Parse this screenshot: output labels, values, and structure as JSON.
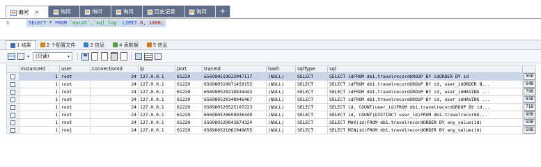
{
  "query_tabs": [
    {
      "label": "询问",
      "active": true
    },
    {
      "label": "询问",
      "active": false
    },
    {
      "label": "询问",
      "active": false
    },
    {
      "label": "询问",
      "active": false
    },
    {
      "label": "历史记录",
      "active": false
    },
    {
      "label": "询问",
      "active": false
    }
  ],
  "query_tab_close": "×",
  "query_tab_add": "+",
  "editor": {
    "line_number": "1",
    "kw_select": "SELECT",
    "star": " * ",
    "kw_from": "FROM",
    "table_ref": " `mycat`.`sql_log` ",
    "kw_limit": "LIMIT",
    "limit_values": " 0, 1000;"
  },
  "result_tabs": [
    {
      "label": "1 结果",
      "active": true,
      "color": "#3b6fb6"
    },
    {
      "label": "2 个配置文件",
      "active": false,
      "color": "#d08a1c"
    },
    {
      "label": "3 信息",
      "active": false,
      "color": "#2f7fcf"
    },
    {
      "label": "4 表数据",
      "active": false,
      "color": "#5a9a3a"
    },
    {
      "label": "5 信息",
      "active": false,
      "color": "#d07a1c"
    }
  ],
  "toolbar": {
    "readonly_select": "(只读)",
    "icons": [
      "grid-view-icon",
      "export-icon",
      "save-icon",
      "copy-icon",
      "paste-icon",
      "delete-icon",
      "filter-icon",
      "text-view-icon",
      "form-view-icon"
    ]
  },
  "grid": {
    "columns": [
      "instanceId",
      "user",
      "connectionId",
      "ip",
      "port",
      "traceId",
      "hash",
      "sqlType",
      "sql"
    ],
    "rows": [
      {
        "instanceId": "1",
        "user": "root",
        "connectionId": "24",
        "ip": "127.0.0.1",
        "port": "61220",
        "traceId": "656980519833047117",
        "hash": "(NULL)",
        "sqlType": "SELECT",
        "sql": "SELECT idFROM db1.travelrecordGROUP BY idORDER BY id",
        "size": "55B",
        "selected": true
      },
      {
        "instanceId": "1",
        "user": "root",
        "connectionId": "24",
        "ip": "127.0.0.1",
        "port": "61220",
        "traceId": "656980519971459155",
        "hash": "(NULL)",
        "sqlType": "SELECT",
        "sql": "SELECT idFROM db1.travelrecordGROUP BY id, user_idORDER B...",
        "size": "64B",
        "selected": false
      },
      {
        "instanceId": "1",
        "user": "root",
        "connectionId": "24",
        "ip": "127.0.0.1",
        "port": "61220",
        "traceId": "656980520210834443",
        "hash": "(NULL)",
        "sqlType": "SELECT",
        "sql": "SELECT idFROM db1.travelrecordGROUP BY id, user_idHAVING ...",
        "size": "79B",
        "selected": false
      },
      {
        "instanceId": "1",
        "user": "root",
        "connectionId": "24",
        "ip": "127.0.0.1",
        "port": "61220",
        "traceId": "656980520348946467",
        "hash": "(NULL)",
        "sqlType": "SELECT",
        "sql": "SELECT idFROM db1.travelrecordGROUP BY id, user_idHAVING ...",
        "size": "83B",
        "selected": false
      },
      {
        "instanceId": "1",
        "user": "root",
        "connectionId": "24",
        "ip": "127.0.0.1",
        "port": "61220",
        "traceId": "656980520525107223",
        "hash": "(NULL)",
        "sqlType": "SELECT",
        "sql": "SELECT id, COUNT(user_id)FROM db1.travelrecordGROUP BY id...",
        "size": "71B",
        "selected": false
      },
      {
        "instanceId": "1",
        "user": "root",
        "connectionId": "24",
        "ip": "127.0.0.1",
        "port": "61220",
        "traceId": "656980520650936349",
        "hash": "(NULL)",
        "sqlType": "SELECT",
        "sql": "SELECT id, COUNT(DISTINCT user_id)FROM db1.travelrecordG...",
        "size": "80B",
        "selected": false
      },
      {
        "instanceId": "1",
        "user": "root",
        "connectionId": "24",
        "ip": "127.0.0.1",
        "port": "61220",
        "traceId": "656980520843874324",
        "hash": "(NULL)",
        "sqlType": "SELECT",
        "sql": "SELECT MAX(id)FROM db1.travelrecordORDER BY any_value(id)",
        "size": "59B",
        "selected": false
      },
      {
        "instanceId": "1",
        "user": "root",
        "connectionId": "24",
        "ip": "127.0.0.1",
        "port": "61220",
        "traceId": "656980521062949655",
        "hash": "(NULL)",
        "sqlType": "SELECT",
        "sql": "SELECT MIN(id)FROM db1.travelrecordORDER BY any_value(id)",
        "size": "59B",
        "selected": false
      }
    ]
  },
  "colors": {
    "tab_inactive": "#5f6e86",
    "selection": "#c8d6ea",
    "keyword": "#2a3cd8",
    "string": "#108a28",
    "number": "#a31515"
  }
}
